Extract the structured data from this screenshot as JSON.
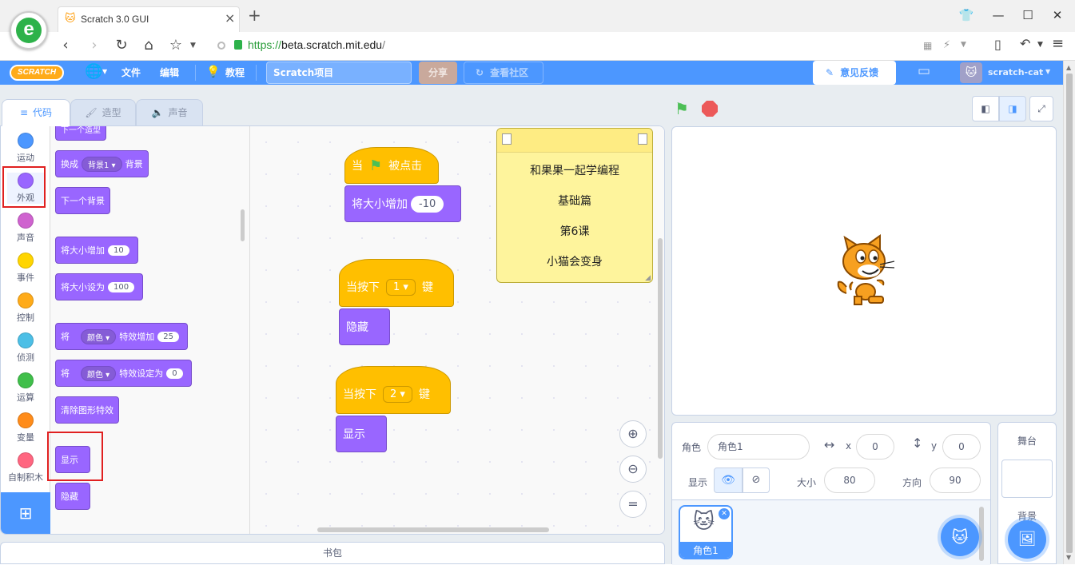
{
  "browser": {
    "tab_title": "Scratch 3.0 GUI",
    "url_scheme": "https://",
    "url_host": "beta.scratch.mit.edu",
    "url_path": "/",
    "new_tab": "+",
    "close_tab": "×"
  },
  "menubar": {
    "logo": "SCRATCH",
    "file": "文件",
    "edit": "编辑",
    "tutorials": "教程",
    "project_title": "Scratch项目",
    "share": "分享",
    "see_community": "查看社区",
    "feedback": "意见反馈",
    "username": "scratch-cat"
  },
  "tabs": {
    "code": "代码",
    "costumes": "造型",
    "sounds": "声音"
  },
  "categories": [
    {
      "label": "运动",
      "color": "#4c97ff"
    },
    {
      "label": "外观",
      "color": "#9966ff"
    },
    {
      "label": "声音",
      "color": "#cf63cf"
    },
    {
      "label": "事件",
      "color": "#ffd500"
    },
    {
      "label": "控制",
      "color": "#ffab19"
    },
    {
      "label": "侦测",
      "color": "#4cbfe6"
    },
    {
      "label": "运算",
      "color": "#40bf4a"
    },
    {
      "label": "变量",
      "color": "#ff8c1a"
    },
    {
      "label": "自制积木",
      "color": "#ff6680"
    }
  ],
  "palette": {
    "next_costume_partial": "下一个造型",
    "switch_backdrop": "换成",
    "backdrop1": "背景1",
    "backdrop_suffix": "背景",
    "next_backdrop": "下一个背景",
    "change_size": "将大小增加",
    "change_size_val": "10",
    "set_size": "将大小设为",
    "set_size_val": "100",
    "effect_prefix": "将",
    "color_effect": "颜色",
    "effect_change": "特效增加",
    "effect_change_val": "25",
    "effect_set": "特效设定为",
    "effect_set_val": "0",
    "clear_effects": "清除图形特效",
    "show": "显示",
    "hide": "隐藏"
  },
  "scripts": {
    "when_prefix": "当",
    "when_suffix": "被点击",
    "change_size": "将大小增加",
    "change_size_val": "-10",
    "when_key": "当按下",
    "key1": "1",
    "key_suffix": "键",
    "hide": "隐藏",
    "key2": "2",
    "show": "显示"
  },
  "note": {
    "line1": "和果果一起学编程",
    "line2": "基础篇",
    "line3": "第6课",
    "line4": "小猫会变身"
  },
  "backpack": "书包",
  "sprite_info": {
    "sprite_label": "角色",
    "sprite_name": "角色1",
    "x_label": "x",
    "x_value": "0",
    "y_label": "y",
    "y_value": "0",
    "show_label": "显示",
    "size_label": "大小",
    "size_value": "80",
    "direction_label": "方向",
    "direction_value": "90"
  },
  "sprite_tile": "角色1",
  "stage_panel": {
    "title": "舞台",
    "backdrops_label": "背景"
  },
  "colors": {
    "scratch_blue": "#4c97ff",
    "looks_purple": "#9966ff",
    "events_yellow": "#ffbf00",
    "highlight_red": "#e02020",
    "green_flag": "#4cbf56",
    "stop_red": "#ec5959"
  }
}
